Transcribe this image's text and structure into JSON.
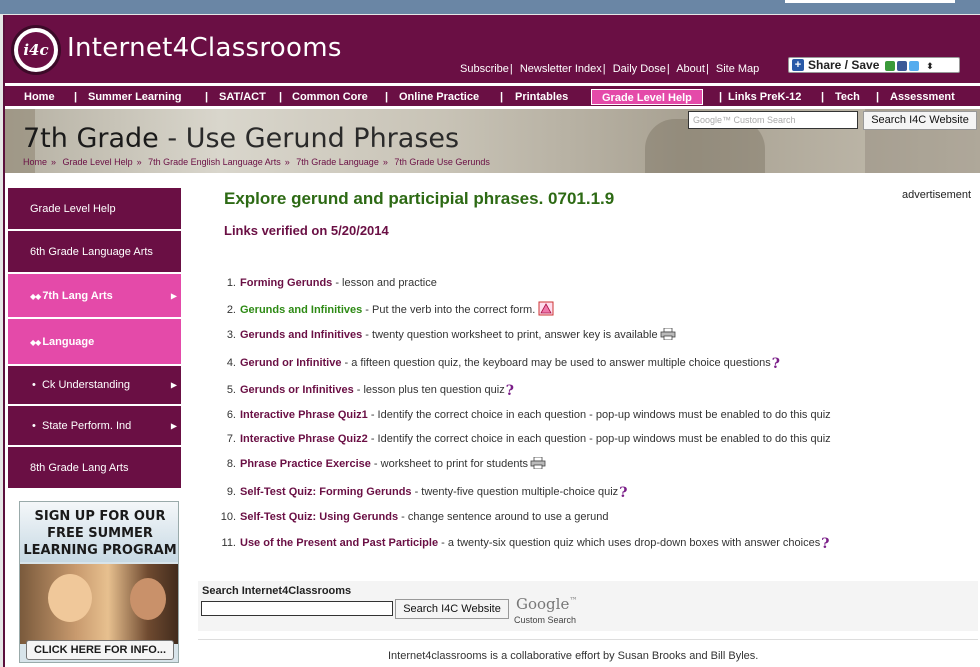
{
  "site": {
    "logo_text": "Internet4Classrooms",
    "logo_mark": "i4c"
  },
  "top_links": [
    "Subscribe",
    "Newsletter Index",
    "Daily Dose",
    "About",
    "Site Map"
  ],
  "share": {
    "label": "Share / Save",
    "arrow": "⬍"
  },
  "nav": {
    "items": [
      "Home",
      "Summer Learning",
      "SAT/ACT",
      "Common Core",
      "Online Practice",
      "Printables",
      "Grade Level Help",
      "Links PreK-12",
      "Tech",
      "Assessment"
    ],
    "active": "Grade Level Help",
    "separator": "|"
  },
  "banner": {
    "title_grade": "7th Grade",
    "title_rest": " - Use Gerund Phrases",
    "breadcrumbs": [
      "Home",
      "Grade Level Help",
      "7th Grade English Language Arts",
      "7th Grade Language",
      "7th Grade Use Gerunds"
    ],
    "crumb_sep": "»",
    "search_placeholder": "Google™ Custom Search",
    "search_button": "Search I4C Website"
  },
  "sidebar": {
    "items": [
      {
        "label": "Grade Level Help"
      },
      {
        "label": "6th Grade Language Arts"
      },
      {
        "label": "7th Lang Arts",
        "bullets": "◆◆"
      },
      {
        "label": "Language",
        "bullets": "◆◆"
      },
      {
        "label": "Ck Understanding"
      },
      {
        "label": "State Perform. Ind"
      },
      {
        "label": "8th Grade Lang Arts"
      }
    ],
    "arrow": "▶",
    "ad": {
      "headline": "SIGN UP FOR OUR FREE SUMMER LEARNING PROGRAM",
      "cta": "CLICK HERE FOR INFO..."
    }
  },
  "main": {
    "heading": "Explore gerund and participial phrases. 0701.1.9",
    "verified": "Links verified on 5/20/2014",
    "advertisement_label": "advertisement",
    "resources": [
      {
        "num": "1.",
        "title": "Forming Gerunds",
        "desc": " - lesson and practice"
      },
      {
        "num": "2.",
        "title": "Gerunds and Infinitives",
        "desc": "  - Put the verb into the correct form."
      },
      {
        "num": "3.",
        "title": "Gerunds and Infinitives",
        "desc": "  - twenty question worksheet to print, answer key is available"
      },
      {
        "num": "4.",
        "title": "Gerund or Infinitive",
        "desc": "  - a fifteen question quiz, the keyboard may be used to answer multiple choice questions"
      },
      {
        "num": "5.",
        "title": "Gerunds or Infinitives",
        "desc": "  - lesson plus ten question quiz"
      },
      {
        "num": "6.",
        "title": "Interactive Phrase Quiz1",
        "desc": " - Identify the correct choice in each question - pop-up windows must be enabled to do this quiz"
      },
      {
        "num": "7.",
        "title": "Interactive Phrase Quiz2",
        "desc": " - Identify the correct choice in each question - pop-up windows must be enabled to do this quiz"
      },
      {
        "num": "8.",
        "title": "Phrase Practice Exercise",
        "desc": " - worksheet to print for students"
      },
      {
        "num": "9.",
        "title": "Self-Test Quiz: Forming Gerunds",
        "desc": "  - twenty-five question multiple-choice quiz"
      },
      {
        "num": "10.",
        "title": "Self-Test Quiz: Using Gerunds",
        "desc": "  - change sentence around to use a gerund"
      },
      {
        "num": "11.",
        "title": "Use of the Present and Past Participle",
        "desc": "  - a twenty-six question quiz which uses drop-down boxes with answer choices"
      }
    ]
  },
  "bottom_search": {
    "label": "Search Internet4Classrooms",
    "button": "Search I4C Website",
    "google": "Google",
    "tm": "™",
    "custom": "Custom Search"
  },
  "footer": {
    "text": "Internet4classrooms is a collaborative effort by Susan Brooks and Bill Byles."
  },
  "colors": {
    "brand": "#6a0f44",
    "accent_pink": "#e44aa9",
    "heading_green": "#2d6a14",
    "link_green": "#2d8a14",
    "quiz_purple": "#7a1e88"
  }
}
